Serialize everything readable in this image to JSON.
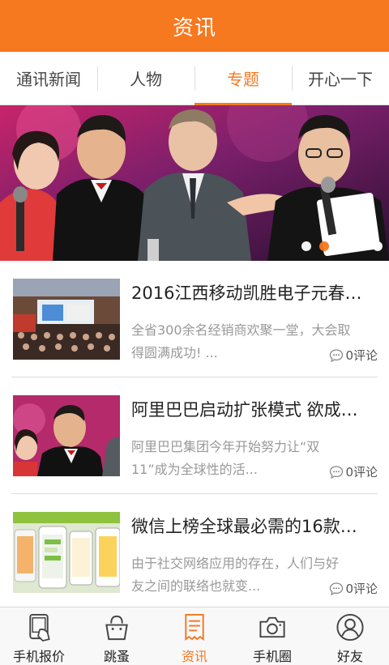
{
  "header": {
    "title": "资讯"
  },
  "tabs": [
    {
      "label": "通讯新闻",
      "active": false
    },
    {
      "label": "人物",
      "active": false
    },
    {
      "label": "专题",
      "active": true
    },
    {
      "label": "开心一下",
      "active": false
    }
  ],
  "banner": {
    "slide_count": 5,
    "active_index": 1
  },
  "news": [
    {
      "title": "2016江西移动凯胜电子元春…",
      "summary_line1": "全省300余名经销商欢聚一堂，大会取",
      "summary_line2": "得圆满成功! ...",
      "comments": "0评论"
    },
    {
      "title": "阿里巴巴启动扩张模式 欲成…",
      "summary_line1": "阿里巴巴集团今年开始努力让“双",
      "summary_line2": "11”成为全球性的活...",
      "comments": "0评论"
    },
    {
      "title": "微信上榜全球最必需的16款…",
      "summary_line1": "由于社交网络应用的存在，人们与好",
      "summary_line2": "友之间的联络也就变...",
      "comments": "0评论"
    }
  ],
  "nav": [
    {
      "label": "手机报价",
      "icon": "phone-price-icon"
    },
    {
      "label": "跳蚤",
      "icon": "bag-icon"
    },
    {
      "label": "资讯",
      "icon": "news-icon",
      "active": true
    },
    {
      "label": "手机圈",
      "icon": "camera-icon"
    },
    {
      "label": "好友",
      "icon": "friend-icon"
    }
  ],
  "colors": {
    "accent": "#f6781f"
  }
}
